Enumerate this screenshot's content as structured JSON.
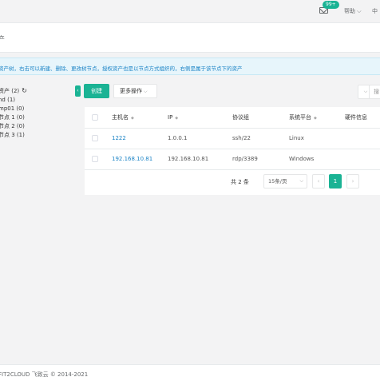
{
  "header": {
    "badge": "99+",
    "help": "帮助",
    "help_chevron": "⌵",
    "lang": "中",
    "title_fragment": "产"
  },
  "notice": "资产树，右击可以新建、删除、更改树节点，授权资产也是以节点方式组织的，右侧是属于该节点下的资产",
  "tree": {
    "items": [
      "资产 (2)",
      "nd (1)",
      "mp01 (0)",
      "节点 1 (0)",
      "节点 2 (0)",
      "节点 3 (1)"
    ],
    "refresh_icon": "↻"
  },
  "toolbar": {
    "collapse_label": "‹",
    "create_label": "创建",
    "more_label": "更多操作",
    "more_chevron": "⌵",
    "filter_chevron": "⌵",
    "search_placeholder": "搜"
  },
  "table": {
    "headers": [
      "主机名",
      "IP",
      "协议组",
      "系统平台",
      "硬件信息"
    ],
    "sort_icon": "◆",
    "rows": [
      {
        "hostname": "1222",
        "ip": "1.0.0.1",
        "protocols": "ssh/22",
        "platform": "Linux"
      },
      {
        "hostname": "192.168.10.81",
        "ip": "192.168.10.81",
        "protocols": "rdp/3389",
        "platform": "Windows"
      }
    ]
  },
  "pagination": {
    "total": "共 2 条",
    "page_size": "15条/页",
    "page_size_chevron": "⌵",
    "prev": "‹",
    "current": "1",
    "next": "›"
  },
  "footer": "FIT2CLOUD 飞致云 © 2014-2021",
  "colors": {
    "accent": "#1ab394",
    "link": "#1c84c6",
    "notice_bg": "#e7f5fb"
  }
}
